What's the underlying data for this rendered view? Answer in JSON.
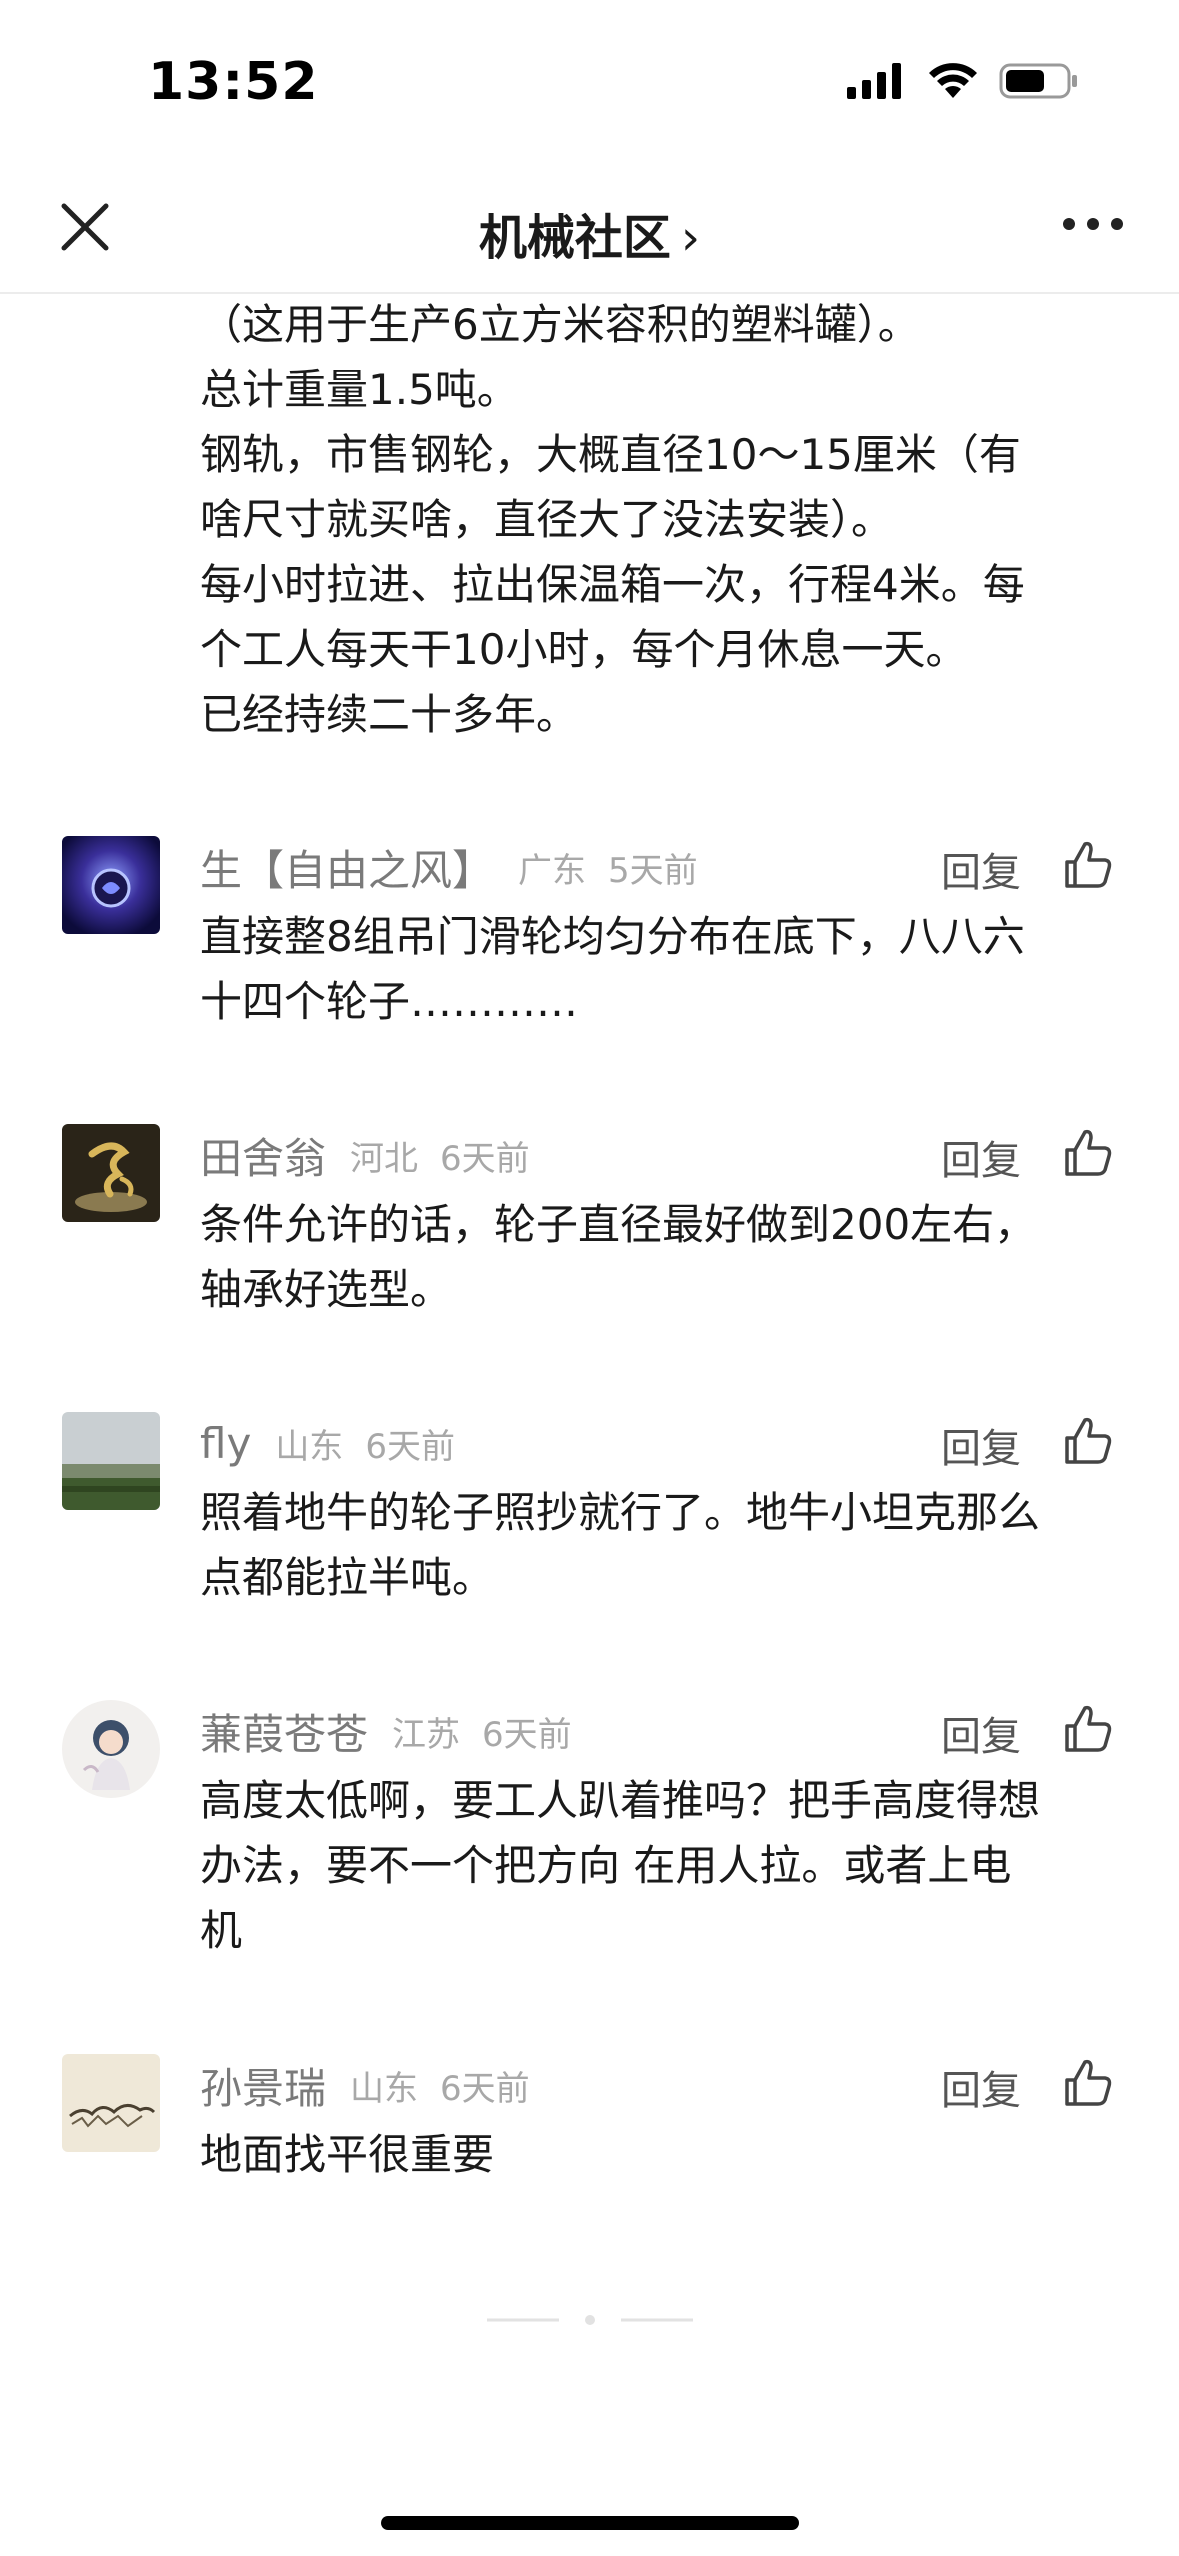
{
  "status_bar": {
    "time": "13:52"
  },
  "nav": {
    "title": "机械社区",
    "chevron": "›"
  },
  "post_text": [
    "（这用于生产6立方米容积的塑料罐）。",
    "总计重量1.5吨。",
    "钢轨，市售钢轮，大概直径10～15厘米（有",
    "啥尺寸就买啥，直径大了没法安装）。",
    "每小时拉进、拉出保温箱一次，行程4米。每",
    "个工人每天干10小时，每个月休息一天。",
    "已经持续二十多年。"
  ],
  "reply_label": "回复",
  "comments": [
    {
      "name": "生【自由之风】",
      "location": "广东",
      "time": "5天前",
      "lines": [
        "直接整8组吊门滑轮均匀分布在底下，八八六",
        "十四个轮子…………"
      ],
      "avatar": "galaxy-avatar"
    },
    {
      "name": "田舍翁",
      "location": "河北",
      "time": "6天前",
      "lines": [
        "条件允许的话，轮子直径最好做到200左右，",
        "轴承好选型。"
      ],
      "avatar": "calligraphy-avatar"
    },
    {
      "name": "fly",
      "location": "山东",
      "time": "6天前",
      "lines": [
        "照着地牛的轮子照抄就行了。地牛小坦克那么",
        "点都能拉半吨。"
      ],
      "avatar": "landscape-avatar"
    },
    {
      "name": "蒹葭苍苍",
      "location": "江苏",
      "time": "6天前",
      "lines": [
        "高度太低啊，要工人趴着推吗？把手高度得想",
        "办法，要不一个把方向 在用人拉。或者上电",
        "机"
      ],
      "avatar": "anime-girl-avatar"
    },
    {
      "name": "孙景瑞",
      "location": "山东",
      "time": "6天前",
      "lines": [
        "地面找平很重要"
      ],
      "avatar": "sketch-avatar"
    }
  ]
}
